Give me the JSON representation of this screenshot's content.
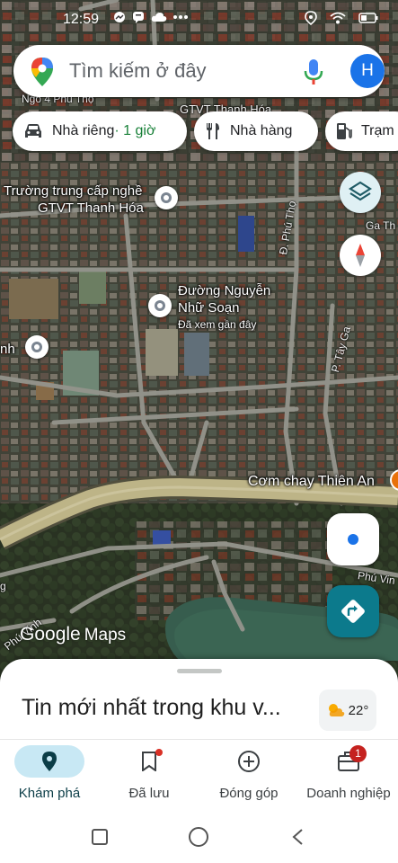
{
  "status_bar": {
    "time": "12:59",
    "left_icons": [
      "messenger-icon",
      "chat-icon",
      "cloud-icon",
      "more-dots-icon"
    ],
    "right_icons": [
      "location-icon",
      "wifi-icon",
      "battery-icon"
    ]
  },
  "search": {
    "placeholder": "Tìm kiếm ở đây",
    "avatar_letter": "H",
    "brand_color": "#1a73e8"
  },
  "chips": [
    {
      "icon": "car-icon",
      "label": "Nhà riêng",
      "sub": " · 1 giờ"
    },
    {
      "icon": "restaurant-icon",
      "label": "Nhà hàng"
    },
    {
      "icon": "gas-station-icon",
      "label": "Trạm"
    }
  ],
  "map": {
    "places": [
      {
        "name": "Trường trung cấp nghề",
        "name2": "GTVT Thanh Hóa"
      },
      {
        "name": "Đường Nguyễn",
        "name2": "Nhữ Soạn",
        "note": "Đã xem gần đây"
      },
      {
        "name": "nh"
      },
      {
        "name": "Cơm chay Thiên An"
      },
      {
        "name": "GTVT Thanh Hóa"
      },
      {
        "name": "Ngõ 4 Phú Thọ"
      }
    ],
    "streets": [
      "Đ. Phú Thọ",
      "P. Tây Ga",
      "Ga Th",
      "Phú Vin",
      "Phú Vinh",
      "g"
    ],
    "attribution": "Google",
    "attribution_maps": "Maps"
  },
  "sheet": {
    "title": "Tin mới nhất trong khu v...",
    "weather_temp": "22°",
    "weather_icon": "partly-cloudy-icon"
  },
  "bottom_nav": [
    {
      "icon": "explore-pin-icon",
      "label": "Khám phá",
      "active": true
    },
    {
      "icon": "bookmark-icon",
      "label": "Đã lưu"
    },
    {
      "icon": "add-circle-icon",
      "label": "Đóng góp"
    },
    {
      "icon": "store-icon",
      "label": "Doanh nghiệp",
      "badge": "1"
    }
  ]
}
